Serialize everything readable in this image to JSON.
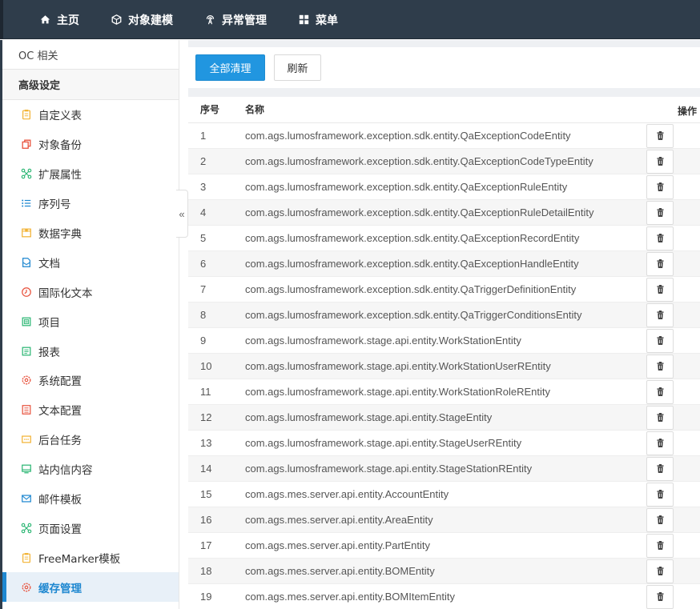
{
  "topnav": [
    {
      "label": "主页",
      "icon": "home-icon"
    },
    {
      "label": "对象建模",
      "icon": "cube-icon"
    },
    {
      "label": "异常管理",
      "icon": "broadcast-icon"
    },
    {
      "label": "菜单",
      "icon": "grid-icon"
    }
  ],
  "sidebar": {
    "sections": [
      "OC 相关",
      "高级设定"
    ],
    "items": [
      {
        "label": "自定义表",
        "icon": "clipboard-icon",
        "color": "#f2b233"
      },
      {
        "label": "对象备份",
        "icon": "copy-icon",
        "color": "#e8533e"
      },
      {
        "label": "扩展属性",
        "icon": "network-icon",
        "color": "#2bb673"
      },
      {
        "label": "序列号",
        "icon": "list-icon",
        "color": "#1e87d0"
      },
      {
        "label": "数据字典",
        "icon": "dictionary-icon",
        "color": "#f2b233"
      },
      {
        "label": "文档",
        "icon": "document-icon",
        "color": "#1e87d0"
      },
      {
        "label": "国际化文本",
        "icon": "clock-icon",
        "color": "#e8533e"
      },
      {
        "label": "项目",
        "icon": "project-icon",
        "color": "#2bb673"
      },
      {
        "label": "报表",
        "icon": "report-icon",
        "color": "#2bb673"
      },
      {
        "label": "系统配置",
        "icon": "settings-icon",
        "color": "#e8533e"
      },
      {
        "label": "文本配置",
        "icon": "text-config-icon",
        "color": "#e8533e"
      },
      {
        "label": "后台任务",
        "icon": "task-icon",
        "color": "#f2b233"
      },
      {
        "label": "站内信内容",
        "icon": "message-icon",
        "color": "#2bb673"
      },
      {
        "label": "邮件模板",
        "icon": "mail-icon",
        "color": "#1e87d0"
      },
      {
        "label": "页面设置",
        "icon": "network-icon",
        "color": "#2bb673"
      },
      {
        "label": "FreeMarker模板",
        "icon": "clipboard-icon",
        "color": "#f2b233"
      },
      {
        "label": "缓存管理",
        "icon": "settings-icon",
        "color": "#e8533e",
        "active": true
      }
    ],
    "collapse_label": "«"
  },
  "toolbar": {
    "clear_all_label": "全部清理",
    "refresh_label": "刷新"
  },
  "table": {
    "headers": {
      "no": "序号",
      "name": "名称",
      "op": "操作"
    },
    "rows": [
      {
        "no": "1",
        "name": "com.ags.lumosframework.exception.sdk.entity.QaExceptionCodeEntity"
      },
      {
        "no": "2",
        "name": "com.ags.lumosframework.exception.sdk.entity.QaExceptionCodeTypeEntity"
      },
      {
        "no": "3",
        "name": "com.ags.lumosframework.exception.sdk.entity.QaExceptionRuleEntity"
      },
      {
        "no": "4",
        "name": "com.ags.lumosframework.exception.sdk.entity.QaExceptionRuleDetailEntity"
      },
      {
        "no": "5",
        "name": "com.ags.lumosframework.exception.sdk.entity.QaExceptionRecordEntity"
      },
      {
        "no": "6",
        "name": "com.ags.lumosframework.exception.sdk.entity.QaExceptionHandleEntity"
      },
      {
        "no": "7",
        "name": "com.ags.lumosframework.exception.sdk.entity.QaTriggerDefinitionEntity"
      },
      {
        "no": "8",
        "name": "com.ags.lumosframework.exception.sdk.entity.QaTriggerConditionsEntity"
      },
      {
        "no": "9",
        "name": "com.ags.lumosframework.stage.api.entity.WorkStationEntity"
      },
      {
        "no": "10",
        "name": "com.ags.lumosframework.stage.api.entity.WorkStationUserREntity"
      },
      {
        "no": "11",
        "name": "com.ags.lumosframework.stage.api.entity.WorkStationRoleREntity"
      },
      {
        "no": "12",
        "name": "com.ags.lumosframework.stage.api.entity.StageEntity"
      },
      {
        "no": "13",
        "name": "com.ags.lumosframework.stage.api.entity.StageUserREntity"
      },
      {
        "no": "14",
        "name": "com.ags.lumosframework.stage.api.entity.StageStationREntity"
      },
      {
        "no": "15",
        "name": "com.ags.mes.server.api.entity.AccountEntity"
      },
      {
        "no": "16",
        "name": "com.ags.mes.server.api.entity.AreaEntity"
      },
      {
        "no": "17",
        "name": "com.ags.mes.server.api.entity.PartEntity"
      },
      {
        "no": "18",
        "name": "com.ags.mes.server.api.entity.BOMEntity"
      },
      {
        "no": "19",
        "name": "com.ags.mes.server.api.entity.BOMItemEntity"
      }
    ],
    "row_action_icon": "trash-icon"
  },
  "colors": {
    "topbar": "#2f3d4b",
    "primary": "#2196e0",
    "active_text": "#1e87d0"
  }
}
